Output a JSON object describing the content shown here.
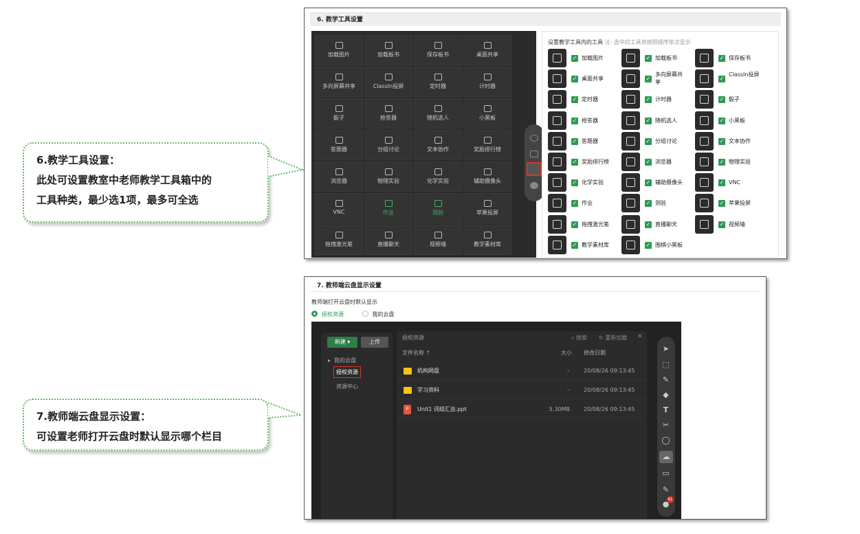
{
  "callout1": {
    "title": "6.教学工具设置：",
    "line1": "此处可设置教室中老师教学工具箱中的",
    "line2": "工具种类，最少选1项，最多可全选"
  },
  "callout2": {
    "title": "7.教师端云盘显示设置：",
    "line1": "可设置老师打开云盘时默认显示哪个栏目"
  },
  "s6": {
    "title": "6. 教学工具设置",
    "toolbox": [
      [
        "加载图片",
        "加载板书",
        "保存板书",
        "桌面共享"
      ],
      [
        "多向屏幕共享",
        "ClassIn投屏",
        "定时器",
        "计时器"
      ],
      [
        "骰子",
        "抢答器",
        "随机选人",
        "小黑板"
      ],
      [
        "答题器",
        "分组讨论",
        "文本协作",
        "奖励排行榜"
      ],
      [
        "浏览器",
        "物理实验",
        "化学实验",
        "辅助摄像头"
      ],
      [
        "VNC",
        "作业",
        "测验",
        "苹果投屏"
      ],
      [
        "拖拽激光笔",
        "直播聊天",
        "视频墙",
        "教学素材库"
      ]
    ],
    "panel_title": "设置教学工具内的工具",
    "panel_hint": "注: 选中的工具将按照顺序依次显示",
    "tools": [
      "加载图片",
      "加载板书",
      "保存板书",
      "桌面共享",
      "多向屏幕共享",
      "ClassIn投屏",
      "定时器",
      "计时器",
      "骰子",
      "抢答器",
      "随机选人",
      "小黑板",
      "答题器",
      "分组讨论",
      "文本协作",
      "奖励排行榜",
      "浏览器",
      "物理实验",
      "化学实验",
      "辅助摄像头",
      "VNC",
      "作业",
      "测验",
      "苹果投屏",
      "拖拽激光笔",
      "直播聊天",
      "视频墙",
      "教学素材库",
      "围棋小黑板"
    ]
  },
  "s7": {
    "title": "7. 教师端云盘显示设置",
    "desc": "教师端打开云盘时默认显示",
    "opt1": "授权资源",
    "opt2": "我的云盘",
    "btn_new": "新建 ▾",
    "btn_upload": "上传",
    "tree": [
      "我的云盘",
      "授权资源",
      "资源中心"
    ],
    "crumb": "授权资源",
    "search": "搜索",
    "reload": "重新加载",
    "col_name": "文件名称 ↑",
    "col_size": "大小",
    "col_date": "修改日期",
    "files": [
      {
        "name": "机构网盘",
        "size": "–",
        "date": "20/08/26 09:13:45",
        "type": "folder"
      },
      {
        "name": "学习资料",
        "size": "–",
        "date": "20/08/26 09:13:45",
        "type": "folder"
      },
      {
        "name": "Unit1 词组汇总.ppt",
        "size": "5.30MB",
        "date": "20/08/26 09:13:45",
        "type": "ppt"
      }
    ],
    "badge": "61"
  },
  "colors": {
    "accent": "#2f9a53",
    "highlight": "#d9352b"
  }
}
